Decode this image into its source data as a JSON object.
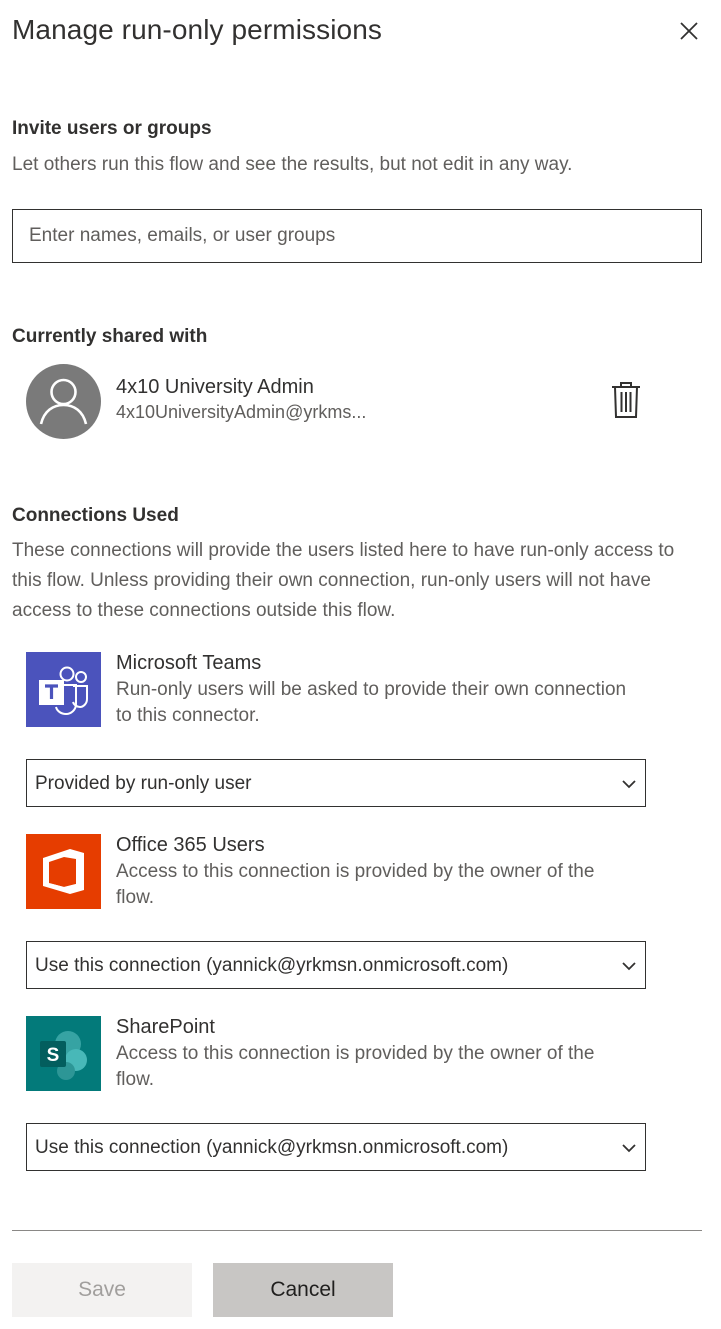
{
  "panel": {
    "title": "Manage run-only permissions",
    "close_icon": "close-icon"
  },
  "invite": {
    "title": "Invite users or groups",
    "description": "Let others run this flow and see the results, but not edit in any way.",
    "placeholder": "Enter names, emails, or user groups",
    "value": ""
  },
  "shared": {
    "title": "Currently shared with",
    "users": [
      {
        "name": "4x10 University Admin",
        "email": "4x10UniversityAdmin@yrkms...",
        "avatar_icon": "person-icon",
        "delete_icon": "trash-icon"
      }
    ]
  },
  "connections": {
    "title": "Connections Used",
    "description_lines": [
      "These connections will provide the users listed here to have run-only access to",
      "this flow. Unless providing their own connection, run-only users will not have",
      "access to these connections outside this flow."
    ],
    "items": [
      {
        "name": "Microsoft Teams",
        "description_lines": [
          "Run-only users will be asked to provide their own connection",
          "to this connector."
        ],
        "icon": "microsoft-teams-icon",
        "selected": "Provided by run-only user"
      },
      {
        "name": "Office 365 Users",
        "description_lines": [
          "Access to this connection is provided by the owner of the",
          "flow."
        ],
        "icon": "office-365-icon",
        "selected": "Use this connection (yannick@yrkmsn.onmicrosoft.com)"
      },
      {
        "name": "SharePoint",
        "description_lines": [
          "Access to this connection is provided by the owner of the",
          "flow."
        ],
        "icon": "sharepoint-icon",
        "selected": "Use this connection (yannick@yrkmsn.onmicrosoft.com)"
      }
    ]
  },
  "footer": {
    "save_label": "Save",
    "cancel_label": "Cancel"
  },
  "colors": {
    "teams": "#4b53bc",
    "office": "#e63d00",
    "sharepoint": "#037a7a",
    "avatar": "#7a7a7a",
    "save_bg": "#f3f2f1",
    "cancel_bg": "#c8c6c4"
  }
}
